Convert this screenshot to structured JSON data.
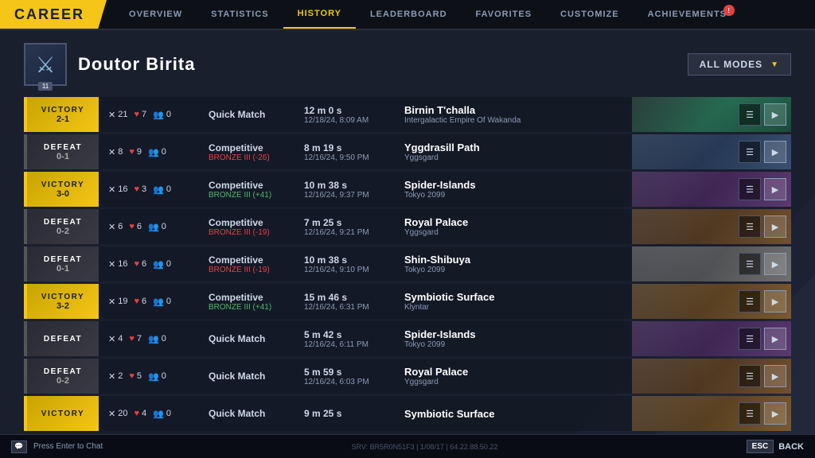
{
  "topnav": {
    "career_label": "CAREER",
    "tabs": [
      {
        "id": "overview",
        "label": "OVERVIEW",
        "active": false
      },
      {
        "id": "statistics",
        "label": "STATISTICS",
        "active": false
      },
      {
        "id": "history",
        "label": "HISTORY",
        "active": true
      },
      {
        "id": "leaderboard",
        "label": "LEADERBOARD",
        "active": false
      },
      {
        "id": "favorites",
        "label": "FAVORITES",
        "active": false
      },
      {
        "id": "customize",
        "label": "CUSTOMIZE",
        "active": false
      },
      {
        "id": "achievements",
        "label": "ACHIEVEMENTS",
        "active": false,
        "badge": "!"
      }
    ]
  },
  "profile": {
    "name": "Doutor Birita",
    "rank": 11,
    "mode_selector": "ALL MODES"
  },
  "matches": [
    {
      "result": "VICTORY",
      "score": "2-1",
      "kills": 21,
      "deaths": 7,
      "assists": 0,
      "mode": "Quick Match",
      "rank_change": "",
      "duration": "12 m 0 s",
      "date": "12/18/24, 8:09 AM",
      "map_name": "Birnin T'challa",
      "map_sub": "Intergalactic Empire Of Wakanda",
      "map_class": "map-birnin",
      "is_victory": true,
      "has_score": true
    },
    {
      "result": "DEFEAT",
      "score": "0-1",
      "kills": 8,
      "deaths": 9,
      "assists": 0,
      "mode": "Competitive",
      "rank_change": "BRONZE III (-26)",
      "rank_positive": false,
      "duration": "8 m 19 s",
      "date": "12/16/24, 9:50 PM",
      "map_name": "Yggdrasill Path",
      "map_sub": "Yggsgard",
      "map_class": "map-yggdrasil",
      "is_victory": false,
      "has_score": true
    },
    {
      "result": "VICTORY",
      "score": "3-0",
      "kills": 16,
      "deaths": 3,
      "assists": 0,
      "mode": "Competitive",
      "rank_change": "BRONZE III (+41)",
      "rank_positive": true,
      "duration": "10 m 38 s",
      "date": "12/16/24, 9:37 PM",
      "map_name": "Spider-Islands",
      "map_sub": "Tokyo 2099",
      "map_class": "map-spider",
      "is_victory": true,
      "has_score": true
    },
    {
      "result": "DEFEAT",
      "score": "0-2",
      "kills": 6,
      "deaths": 6,
      "assists": 0,
      "mode": "Competitive",
      "rank_change": "BRONZE III (-19)",
      "rank_positive": false,
      "duration": "7 m 25 s",
      "date": "12/16/24, 9:21 PM",
      "map_name": "Royal Palace",
      "map_sub": "Yggsgard",
      "map_class": "map-royal",
      "is_victory": false,
      "has_score": true
    },
    {
      "result": "DEFEAT",
      "score": "0-1",
      "kills": 16,
      "deaths": 6,
      "assists": 0,
      "mode": "Competitive",
      "rank_change": "BRONZE III (-19)",
      "rank_positive": false,
      "duration": "10 m 38 s",
      "date": "12/16/24, 9:10 PM",
      "map_name": "Shin-Shibuya",
      "map_sub": "Tokyo 2099",
      "map_class": "map-shin",
      "is_victory": false,
      "has_score": true
    },
    {
      "result": "VICTORY",
      "score": "3-2",
      "kills": 19,
      "deaths": 6,
      "assists": 0,
      "mode": "Competitive",
      "rank_change": "BRONZE III (+41)",
      "rank_positive": true,
      "duration": "15 m 46 s",
      "date": "12/16/24, 6:31 PM",
      "map_name": "Symbiotic Surface",
      "map_sub": "Klyntar",
      "map_class": "map-symbiotic",
      "is_victory": true,
      "has_score": true
    },
    {
      "result": "DEFEAT",
      "score": "",
      "kills": 4,
      "deaths": 7,
      "assists": 0,
      "mode": "Quick Match",
      "rank_change": "",
      "duration": "5 m 42 s",
      "date": "12/16/24, 6:11 PM",
      "map_name": "Spider-Islands",
      "map_sub": "Tokyo 2099",
      "map_class": "map-spider",
      "is_victory": false,
      "has_score": false
    },
    {
      "result": "DEFEAT",
      "score": "0-2",
      "kills": 2,
      "deaths": 5,
      "assists": 0,
      "mode": "Quick Match",
      "rank_change": "",
      "duration": "5 m 59 s",
      "date": "12/16/24, 6:03 PM",
      "map_name": "Royal Palace",
      "map_sub": "Yggsgard",
      "map_class": "map-royal",
      "is_victory": false,
      "has_score": true
    },
    {
      "result": "VICTORY",
      "score": "",
      "kills": 20,
      "deaths": 4,
      "assists": 0,
      "mode": "Quick Match",
      "rank_change": "",
      "duration": "9 m 25 s",
      "date": "",
      "map_name": "Symbiotic Surface",
      "map_sub": "",
      "map_class": "map-symbiotic",
      "is_victory": true,
      "has_score": false
    }
  ],
  "bottom": {
    "chat_hint": "Press Enter to Chat",
    "esc_label": "ESC",
    "back_label": "BACK",
    "server_info": "SRV: BR5R0N51F3 | 1/08/17 | 64.22.88.50.22"
  }
}
